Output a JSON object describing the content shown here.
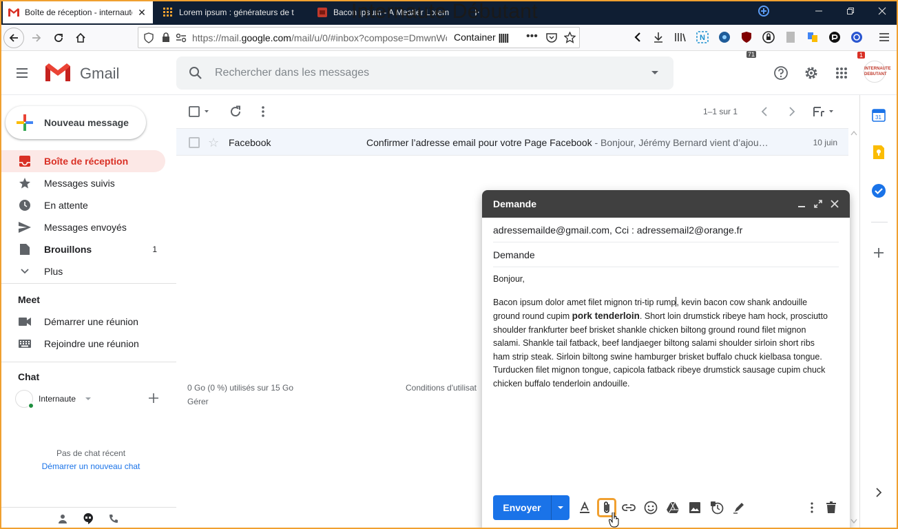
{
  "browser": {
    "tabs": [
      {
        "title": "Boîte de réception - internaute",
        "close": "✕"
      },
      {
        "title": "Lorem ipsum : générateurs de t",
        "close": ""
      },
      {
        "title": "Bacon Ipsum - A Meatier Lorem",
        "close": ""
      }
    ],
    "new_tab": "+",
    "watermark": "Internaute Débutant",
    "url_prefix": "https://mail.",
    "url_domain": "google.com",
    "url_suffix": "/mail/u/0/#inbox?compose=DmwnWc",
    "container_label": "Container",
    "badges": {
      "ublock": "71",
      "notif": "1"
    }
  },
  "gmail": {
    "app_name": "Gmail",
    "search_placeholder": "Rechercher dans les messages",
    "avatar_text": "INTERNAUTE DEBUTANT"
  },
  "sidebar": {
    "compose_label": "Nouveau message",
    "items": [
      {
        "label": "Boîte de réception",
        "count": ""
      },
      {
        "label": "Messages suivis",
        "count": ""
      },
      {
        "label": "En attente",
        "count": ""
      },
      {
        "label": "Messages envoyés",
        "count": ""
      },
      {
        "label": "Brouillons",
        "count": "1"
      },
      {
        "label": "Plus",
        "count": ""
      }
    ],
    "meet_title": "Meet",
    "meet_items": [
      "Démarrer une réunion",
      "Rejoindre une réunion"
    ],
    "chat_title": "Chat",
    "chat_user": "Internaute",
    "no_chat": "Pas de chat récent",
    "start_chat": "Démarrer un nouveau chat"
  },
  "list": {
    "pager": "1–1 sur 1",
    "rows": [
      {
        "sender": "Facebook",
        "subject": "Confirmer l’adresse email pour votre Page Facebook",
        "snippet": " - Bonjour, Jérémy Bernard vient d’ajou…",
        "date": "10 juin"
      }
    ],
    "storage": "0 Go (0 %) utilisés sur 15 Go",
    "manage": "Gérer",
    "terms": "Conditions d'utilisat"
  },
  "compose": {
    "title": "Demande",
    "recipients": "adressemailde@gmail.com, Cci : adressemail2@orange.fr",
    "subject": "Demande",
    "greeting": "Bonjour,",
    "body_part1": "Bacon ipsum dolor amet filet mignon tri-tip rump",
    "body_part2": ", kevin bacon cow shank andouille ground round cupim ",
    "body_bold": "pork tenderloin",
    "body_part3": ". Short loin drumstick ribeye ham hock, prosciutto shoulder frankfurter beef brisket shankle chicken biltong ground round filet mignon salami. Shankle tail fatback, beef landjaeger biltong salami shoulder sirloin short ribs ham strip steak. Sirloin biltong swine hamburger brisket buffalo chuck kielbasa tongue. Turducken filet mignon tongue, capicola fatback ribeye drumstick sausage cupim chuck chicken buffalo tenderloin andouille.",
    "send_label": "Envoyer"
  },
  "colors": {
    "accent_red": "#d93025",
    "send_blue": "#1a73e8",
    "highlight_orange": "#f0a030",
    "compose_header": "#404040"
  }
}
